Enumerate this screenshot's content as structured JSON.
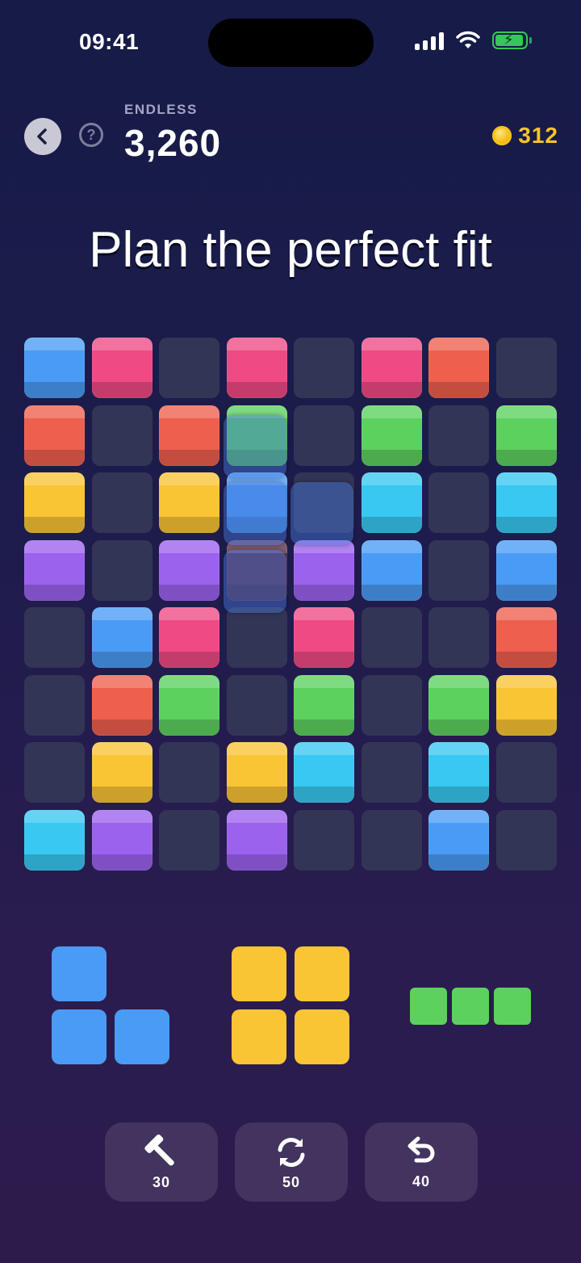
{
  "status_bar": {
    "time": "09:41",
    "signal_bars": 4,
    "battery_charging": true
  },
  "header": {
    "mode": "ENDLESS",
    "score": "3,260",
    "coins": "312"
  },
  "headline": "Plan the perfect fit",
  "colors": {
    "B": "#4a9bf5",
    "P": "#ef4a83",
    "R": "#ee5f4d",
    "G": "#5cd15e",
    "Y": "#f9c535",
    "C": "#38c8f1",
    "V": "#9b62ee",
    "M": "#5a2f48",
    "empty": "#333556"
  },
  "board": {
    "rows": [
      [
        "B",
        "P",
        ".",
        "P",
        ".",
        "P",
        "R",
        "."
      ],
      [
        "R",
        ".",
        "R",
        "G",
        ".",
        "G",
        ".",
        "G"
      ],
      [
        "Y",
        ".",
        "Y",
        "B",
        ".",
        "C",
        ".",
        "C"
      ],
      [
        "V",
        ".",
        "V",
        "M",
        "V",
        "B",
        ".",
        "B"
      ],
      [
        ".",
        "B",
        "P",
        ".",
        "P",
        ".",
        ".",
        "R"
      ],
      [
        ".",
        "R",
        "G",
        ".",
        "G",
        ".",
        "G",
        "Y"
      ],
      [
        ".",
        "Y",
        ".",
        "Y",
        "C",
        ".",
        "C",
        "."
      ],
      [
        "C",
        "V",
        ".",
        "V",
        ".",
        ".",
        "B",
        "."
      ]
    ],
    "ghost_cells": [
      [
        1,
        3
      ],
      [
        2,
        3
      ],
      [
        3,
        3
      ],
      [
        2,
        4
      ]
    ]
  },
  "pieces": [
    {
      "name": "L piece",
      "color": "B",
      "cells": [
        [
          0,
          0
        ],
        [
          1,
          0
        ],
        [
          1,
          1
        ]
      ]
    },
    {
      "name": "Square piece",
      "color": "Y",
      "cells": [
        [
          0,
          0
        ],
        [
          0,
          1
        ],
        [
          1,
          0
        ],
        [
          1,
          1
        ]
      ]
    },
    {
      "name": "Line piece",
      "color": "G",
      "cells": [
        [
          0,
          0
        ],
        [
          0,
          1
        ],
        [
          0,
          2
        ]
      ]
    }
  ],
  "tools": [
    {
      "name": "hammer",
      "count": "30"
    },
    {
      "name": "refresh",
      "count": "50"
    },
    {
      "name": "undo",
      "count": "40"
    }
  ]
}
